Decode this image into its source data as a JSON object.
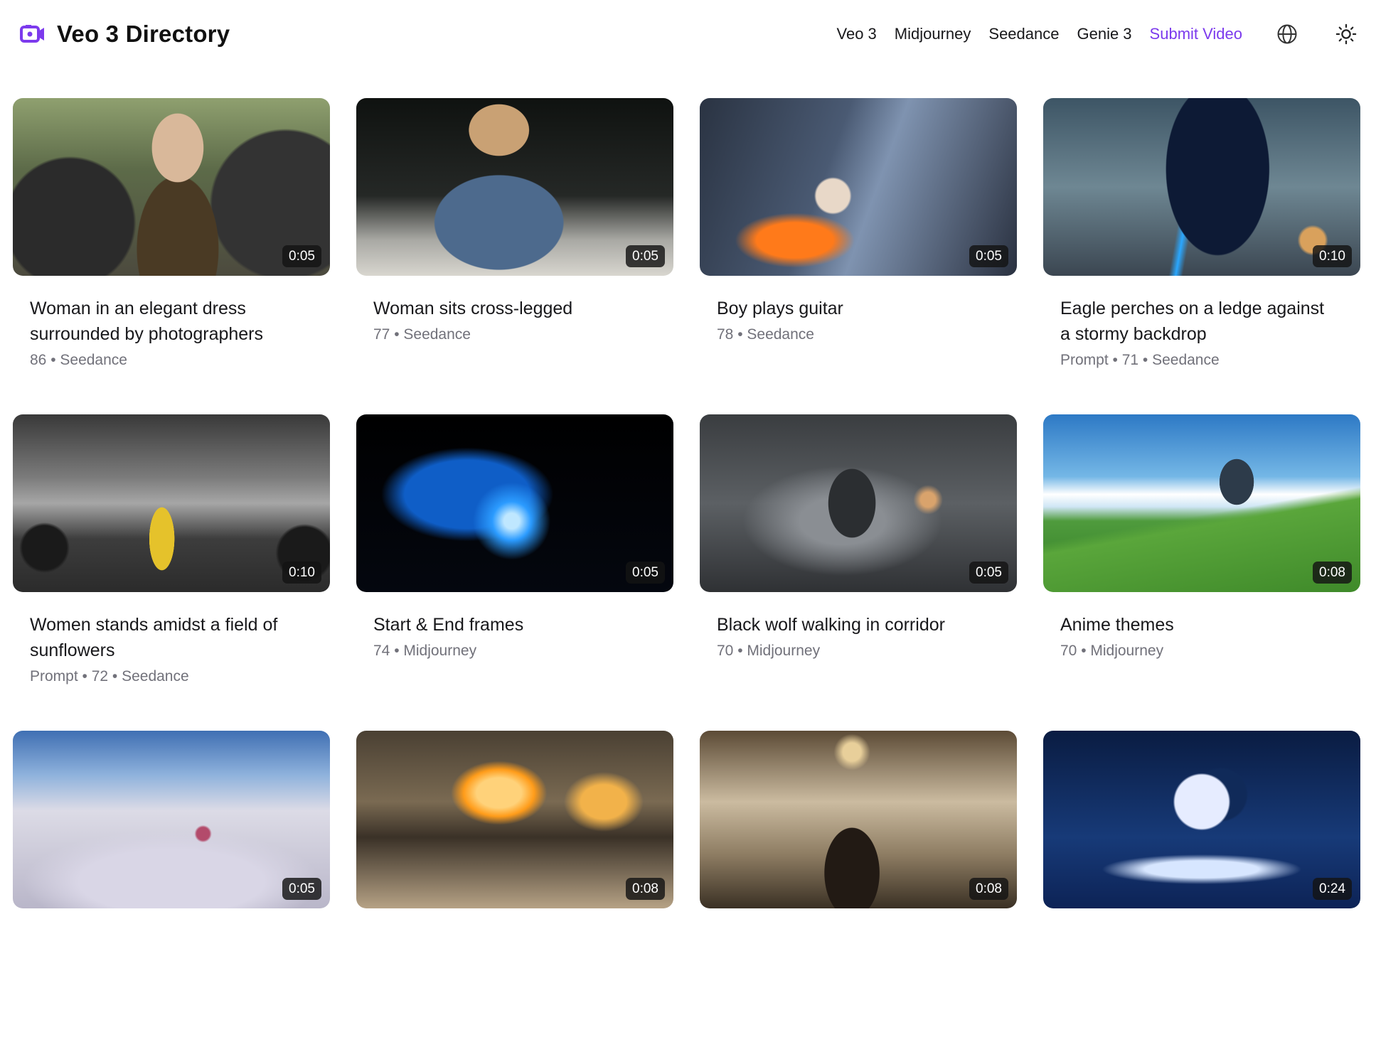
{
  "brand": {
    "title": "Veo 3 Directory",
    "icon": "video-camera-icon",
    "accent_color": "#7c3aed"
  },
  "nav": {
    "links": [
      {
        "label": "Veo 3"
      },
      {
        "label": "Midjourney"
      },
      {
        "label": "Seedance"
      },
      {
        "label": "Genie 3"
      },
      {
        "label": "Submit Video",
        "accent": true
      }
    ],
    "language_icon": "globe-icon",
    "theme_icon": "sun-icon"
  },
  "videos": [
    {
      "title": "Woman in an elegant dress surrounded by photographers",
      "meta": "86 • Seedance",
      "duration": "0:05"
    },
    {
      "title": "Woman sits cross-legged",
      "meta": "77 • Seedance",
      "duration": "0:05"
    },
    {
      "title": "Boy plays guitar",
      "meta": "78 • Seedance",
      "duration": "0:05"
    },
    {
      "title": "Eagle perches on a ledge against a stormy backdrop",
      "meta": "Prompt • 71 • Seedance",
      "duration": "0:10"
    },
    {
      "title": "Women stands amidst a field of sunflowers",
      "meta": "Prompt • 72 • Seedance",
      "duration": "0:10"
    },
    {
      "title": "Start & End frames",
      "meta": "74 • Midjourney",
      "duration": "0:05"
    },
    {
      "title": "Black wolf walking in corridor",
      "meta": "70 • Midjourney",
      "duration": "0:05"
    },
    {
      "title": "Anime themes",
      "meta": "70 • Midjourney",
      "duration": "0:08"
    },
    {
      "title": "",
      "meta": "",
      "duration": "0:05"
    },
    {
      "title": "",
      "meta": "",
      "duration": "0:08"
    },
    {
      "title": "",
      "meta": "",
      "duration": "0:08"
    },
    {
      "title": "",
      "meta": "",
      "duration": "0:24"
    }
  ]
}
